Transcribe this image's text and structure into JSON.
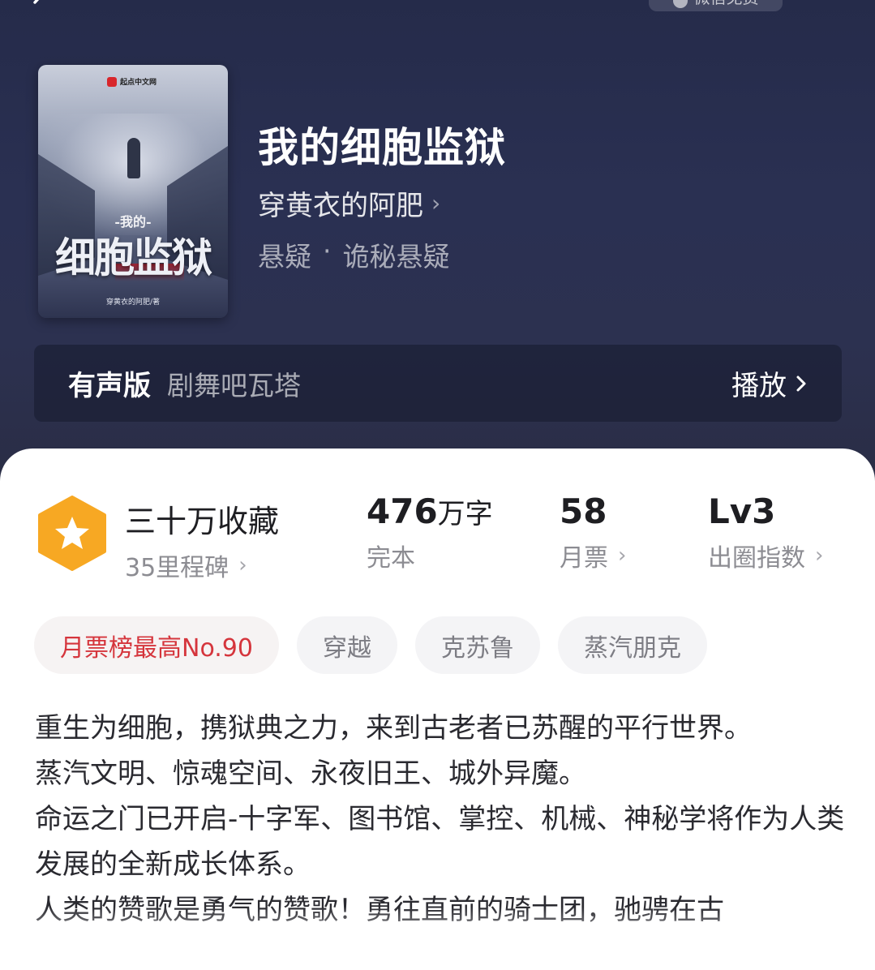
{
  "header": {
    "top_pill_label": "微信免费"
  },
  "book": {
    "cover": {
      "brand": "起点中文网",
      "title_small": "-我的-",
      "title_big": "细胞监狱",
      "byline": "穿黄衣的阿肥/著"
    },
    "title": "我的细胞监狱",
    "author": "穿黄衣的阿肥",
    "category": "悬疑",
    "separator": "·",
    "subcategory": "诡秘悬疑"
  },
  "audio": {
    "label": "有声版",
    "narrator": "剧舞吧瓦塔",
    "play_label": "播放"
  },
  "stats": {
    "favorites": {
      "main": "三十万收藏",
      "sub": "35里程碑"
    },
    "words": {
      "value": "476",
      "unit": "万字",
      "sub": "完本"
    },
    "monthly_tickets": {
      "value": "58",
      "sub": "月票"
    },
    "circle_index": {
      "value": "Lv3",
      "sub": "出圈指数"
    }
  },
  "tags": [
    "月票榜最高No.90",
    "穿越",
    "克苏鲁",
    "蒸汽朋克"
  ],
  "description": [
    "重生为细胞，携狱典之力，来到古老者已苏醒的平行世界。",
    "蒸汽文明、惊魂空间、永夜旧王、城外异魔。",
    "命运之门已开启-十字军、图书馆、掌控、机械、神秘学将作为人类发展的全新成长体系。",
    "人类的赞歌是勇气的赞歌！勇往直前的骑士团，驰骋在古"
  ],
  "colors": {
    "hero_bg": "#2a3052",
    "badge_orange": "#f7a823",
    "tag_hot_red": "#d5353c"
  }
}
